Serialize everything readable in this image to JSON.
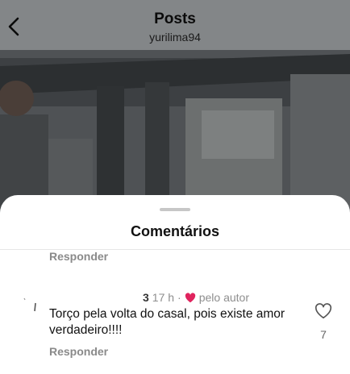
{
  "nav": {
    "title": "Posts",
    "username": "yurilima94",
    "back_icon": "chevron-left-icon"
  },
  "sheet": {
    "title": "Comentários"
  },
  "comments": [
    {
      "reply_label": "Responder"
    },
    {
      "username": "3",
      "time": "17 h",
      "separator": "·",
      "liked_by_author_icon": "heart-filled-icon",
      "liked_by_author_text": "pelo autor",
      "text": "Torço pela volta do casal, pois existe amor verdadeiro!!!!",
      "reply_label": "Responder",
      "like_icon": "heart-outline-icon",
      "like_count": "7"
    }
  ],
  "colors": {
    "heart_red": "#e0245e",
    "muted_text": "#8a8a8a",
    "overlay_nav": "#838688"
  }
}
